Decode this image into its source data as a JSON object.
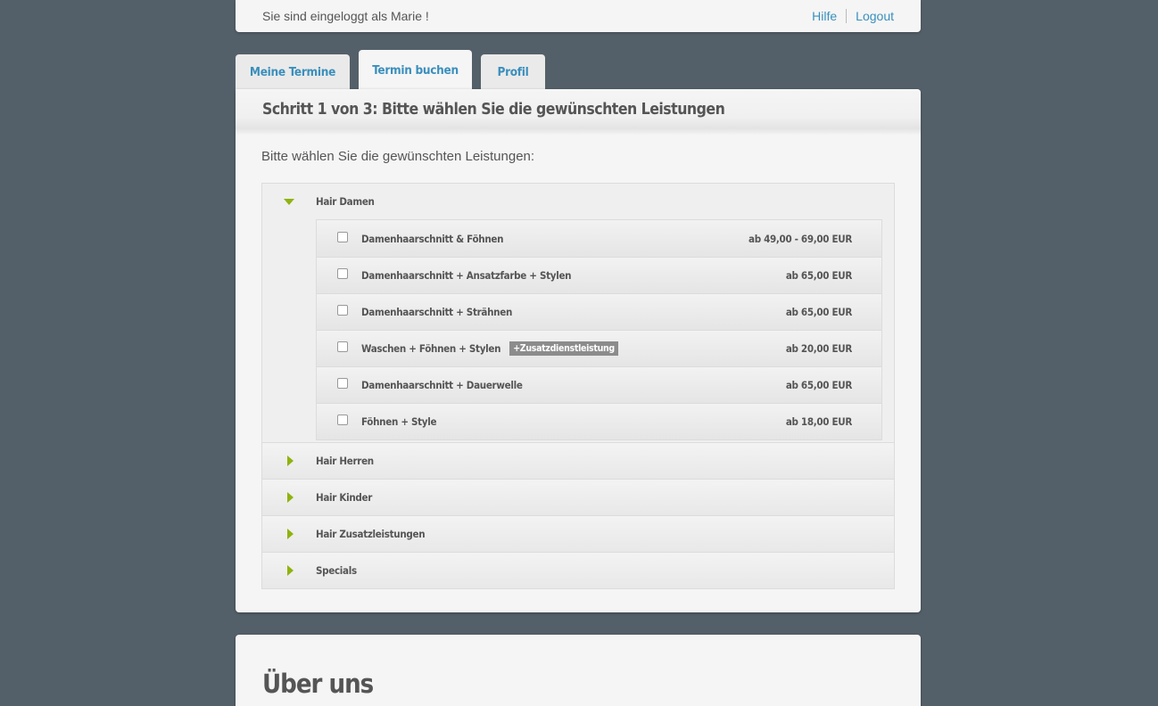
{
  "header": {
    "greeting": "Sie sind eingeloggt als Marie !",
    "help_label": "Hilfe",
    "logout_label": "Logout"
  },
  "tabs": [
    {
      "label": "Meine Termine",
      "active": false
    },
    {
      "label": "Termin buchen",
      "active": true
    },
    {
      "label": "Profil",
      "active": false
    }
  ],
  "step_title": "Schritt 1 von 3: Bitte wählen Sie die gewünschten Leistungen",
  "intro_text": "Bitte wählen Sie die gewünschten Leistungen:",
  "categories": [
    {
      "label": "Hair Damen",
      "expanded": true,
      "services": [
        {
          "name": "Damenhaarschnitt & Föhnen",
          "price": "ab 49,00 - 69,00 EUR",
          "checked": false
        },
        {
          "name": "Damenhaarschnitt + Ansatzfarbe + Stylen",
          "price": "ab 65,00 EUR",
          "checked": false
        },
        {
          "name": "Damenhaarschnitt + Strähnen",
          "price": "ab 65,00 EUR",
          "checked": false
        },
        {
          "name": "Waschen + Föhnen + Stylen",
          "badge": "+Zusatzdienstleistung",
          "price": "ab 20,00 EUR",
          "checked": false
        },
        {
          "name": "Damenhaarschnitt + Dauerwelle",
          "price": "ab 65,00 EUR",
          "checked": false
        },
        {
          "name": "Föhnen + Style",
          "price": "ab 18,00 EUR",
          "checked": false
        }
      ]
    },
    {
      "label": "Hair Herren",
      "expanded": false
    },
    {
      "label": "Hair Kinder",
      "expanded": false
    },
    {
      "label": "Hair Zusatzleistungen",
      "expanded": false
    },
    {
      "label": "Specials",
      "expanded": false
    }
  ],
  "about_title": "Über uns",
  "colors": {
    "background": "#546069",
    "link": "#3a8fbd",
    "accent_triangle": "#8fb30e",
    "badge": "#8c8c8c"
  },
  "icons": {
    "expanded": "triangle-down-icon",
    "collapsed": "triangle-right-icon"
  }
}
